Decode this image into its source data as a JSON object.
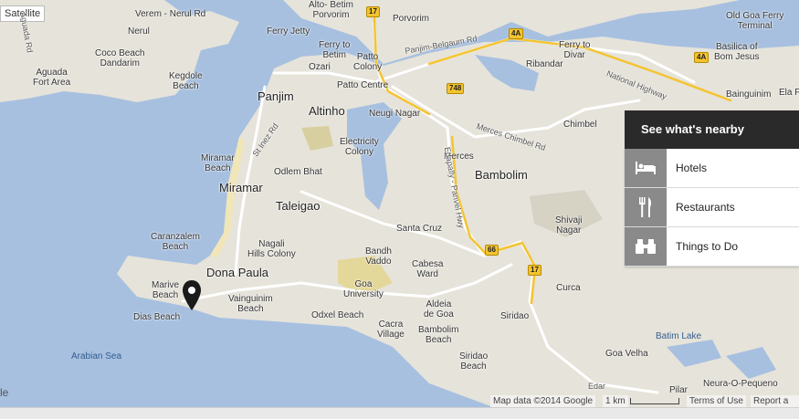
{
  "map_type_button": "Satellite",
  "google_logo": "le",
  "nearby": {
    "title": "See what's nearby",
    "items": [
      {
        "label": "Hotels",
        "icon": "bed-icon"
      },
      {
        "label": "Restaurants",
        "icon": "fork-knife-icon"
      },
      {
        "label": "Things to Do",
        "icon": "binoculars-icon"
      }
    ]
  },
  "footer": {
    "map_data": "Map data ©2014 Google",
    "scale": "1 km",
    "terms": "Terms of Use",
    "report": "Report a m"
  },
  "labels": {
    "verem": "Verem - Nerul Rd",
    "betim": "Alto- Betim\nPorvorim",
    "porvorim": "Porvorim",
    "old_goa": "Old Goa Ferry\nTerminal",
    "nerul": "Nerul",
    "ferry_jetty": "Ferry Jetty",
    "ferry_betim": "Ferry to\nBetim",
    "patto_colony": "Patto\nColony",
    "panjim_belgaum": "Panjim-Belgaum Rd",
    "ferry_divar": "Ferry to\nDivar",
    "basilica": "Basilica of\nBom Jesus",
    "aguada_rd": "Aguada Rd",
    "coco_beach": "Coco Beach\nDandarim",
    "ozari": "Ozari",
    "ribandar": "Ribandar",
    "kegdole": "Kegdole\nBeach",
    "aguada_fort": "Aguada\nFort Area",
    "patto_centre": "Patto Centre",
    "nh": "National Highway",
    "bainguinim": "Bainguinim",
    "ela": "Ela F",
    "panjim": "Panjim",
    "altinho": "Altinho",
    "neugi": "Neugi Nagar",
    "chimbel": "Chimbel",
    "st_inez": "St Inez Rd",
    "electricity": "Electricity\nColony",
    "merces_rd": "Merces Chimbel Rd",
    "miramar_beach": "Miramar\nBeach",
    "odlem": "Odlem Bhat",
    "merces": "Merces",
    "bambolim": "Bambolim",
    "miramar": "Miramar",
    "edapally": "Edapally - Panvel Hwy",
    "taleigao": "Taleigao",
    "shivaji": "Shivaji\nNagar",
    "santa_cruz": "Santa Cruz",
    "caranzalem": "Caranzalem\nBeach",
    "nagali": "Nagali\nHills Colony",
    "bandh": "Bandh\nVaddo",
    "cabesa": "Cabesa\nWard",
    "dona_paula": "Dona Paula",
    "marive": "Marive\nBeach",
    "vainguinim": "Vainguinim\nBeach",
    "goa_univ": "Goa\nUniversity",
    "curca": "Curca",
    "dias": "Dias Beach",
    "odxel": "Odxel Beach",
    "aldeia": "Aldeia\nde Goa",
    "siridao": "Siridao",
    "cacra": "Cacra\nVillage",
    "bambolim_beach": "Bambolim\nBeach",
    "batim": "Batim Lake",
    "arabian": "Arabian Sea",
    "goa_velha": "Goa Velha",
    "siridao_beach": "Siridao\nBeach",
    "neura": "Neura-O-Pequeno",
    "edar": "Edar",
    "pilar": "Pilar"
  },
  "shields": [
    "17",
    "4A",
    "748",
    "4A",
    "66",
    "17"
  ]
}
